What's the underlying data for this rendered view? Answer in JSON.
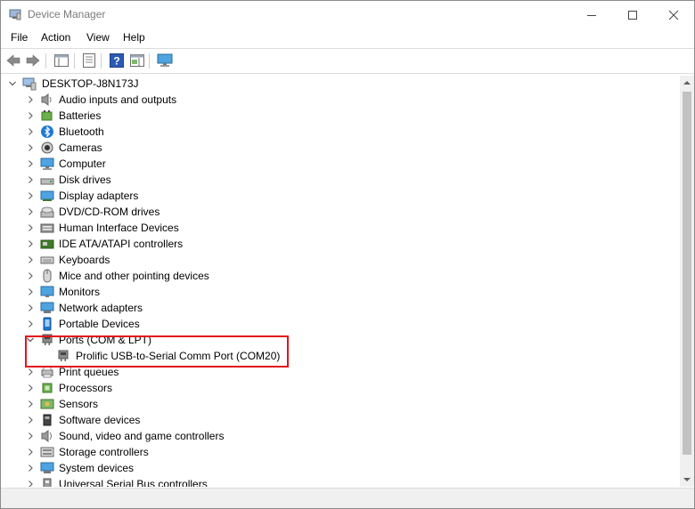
{
  "window": {
    "title": "Device Manager"
  },
  "menu": [
    "File",
    "Action",
    "View",
    "Help"
  ],
  "tree": {
    "root": "DESKTOP-J8N173J",
    "categories": [
      {
        "label": "Audio inputs and outputs",
        "icon": "speaker-icon",
        "expanded": false
      },
      {
        "label": "Batteries",
        "icon": "battery-icon",
        "expanded": false
      },
      {
        "label": "Bluetooth",
        "icon": "bluetooth-icon",
        "expanded": false
      },
      {
        "label": "Cameras",
        "icon": "camera-icon",
        "expanded": false
      },
      {
        "label": "Computer",
        "icon": "computer-icon",
        "expanded": false
      },
      {
        "label": "Disk drives",
        "icon": "disk-drive-icon",
        "expanded": false
      },
      {
        "label": "Display adapters",
        "icon": "display-adapter-icon",
        "expanded": false
      },
      {
        "label": "DVD/CD-ROM drives",
        "icon": "dvd-drive-icon",
        "expanded": false
      },
      {
        "label": "Human Interface Devices",
        "icon": "hid-icon",
        "expanded": false
      },
      {
        "label": "IDE ATA/ATAPI controllers",
        "icon": "ide-controller-icon",
        "expanded": false
      },
      {
        "label": "Keyboards",
        "icon": "keyboard-icon",
        "expanded": false
      },
      {
        "label": "Mice and other pointing devices",
        "icon": "mouse-icon",
        "expanded": false
      },
      {
        "label": "Monitors",
        "icon": "monitor-icon",
        "expanded": false
      },
      {
        "label": "Network adapters",
        "icon": "network-adapter-icon",
        "expanded": false
      },
      {
        "label": "Portable Devices",
        "icon": "portable-device-icon",
        "expanded": false
      },
      {
        "label": "Ports (COM & LPT)",
        "icon": "port-icon",
        "expanded": true,
        "children": [
          {
            "label": "Prolific USB-to-Serial Comm Port (COM20)",
            "icon": "port-icon"
          }
        ]
      },
      {
        "label": "Print queues",
        "icon": "printer-icon",
        "expanded": false
      },
      {
        "label": "Processors",
        "icon": "processor-icon",
        "expanded": false
      },
      {
        "label": "Sensors",
        "icon": "sensor-icon",
        "expanded": false
      },
      {
        "label": "Software devices",
        "icon": "software-device-icon",
        "expanded": false
      },
      {
        "label": "Sound, video and game controllers",
        "icon": "sound-controller-icon",
        "expanded": false
      },
      {
        "label": "Storage controllers",
        "icon": "storage-controller-icon",
        "expanded": false
      },
      {
        "label": "System devices",
        "icon": "system-device-icon",
        "expanded": false
      },
      {
        "label": "Universal Serial Bus controllers",
        "icon": "usb-controller-icon",
        "expanded": false
      }
    ]
  },
  "colors": {
    "highlight_box": "#e1141c",
    "accent_blue": "#1e6fd0"
  }
}
